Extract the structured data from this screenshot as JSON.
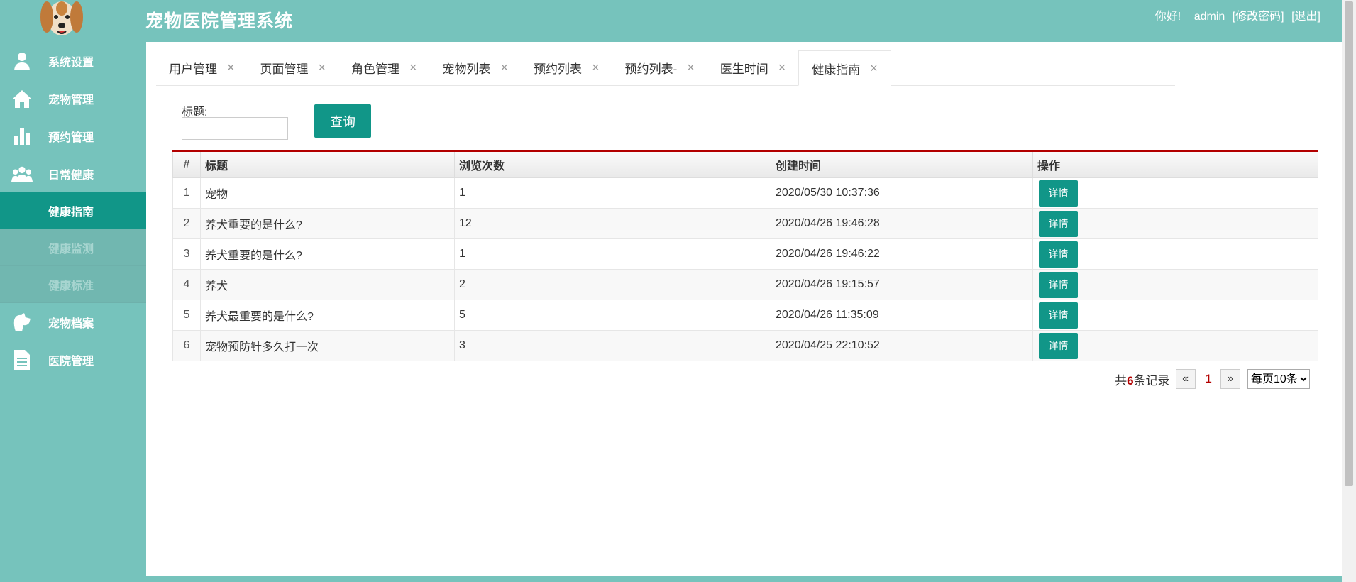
{
  "header": {
    "title": "宠物医院管理系统",
    "greeting": "你好!",
    "username": "admin",
    "change_password": "[修改密码]",
    "logout": "[退出]"
  },
  "sidebar": {
    "items": [
      {
        "label": "系统设置",
        "icon": "user-icon"
      },
      {
        "label": "宠物管理",
        "icon": "home-icon"
      },
      {
        "label": "预约管理",
        "icon": "bar-chart-icon"
      },
      {
        "label": "日常健康",
        "icon": "group-icon"
      }
    ],
    "submenu": [
      {
        "label": "健康指南",
        "active": true
      },
      {
        "label": "健康监测",
        "active": false
      },
      {
        "label": "健康标准",
        "active": false
      }
    ],
    "items_after": [
      {
        "label": "宠物档案",
        "icon": "pet-icon"
      },
      {
        "label": "医院管理",
        "icon": "document-icon"
      }
    ]
  },
  "tabs": [
    {
      "label": "用户管理"
    },
    {
      "label": "页面管理"
    },
    {
      "label": "角色管理"
    },
    {
      "label": "宠物列表"
    },
    {
      "label": "预约列表"
    },
    {
      "label": "预约列表-"
    },
    {
      "label": "医生时间"
    },
    {
      "label": "健康指南",
      "active": true
    }
  ],
  "search": {
    "label": "标题:",
    "value": "",
    "button": "查询"
  },
  "table": {
    "headers": [
      "#",
      "标题",
      "浏览次数",
      "创建时间",
      "操作"
    ],
    "rows": [
      [
        "1",
        "宠物",
        "1",
        "2020/05/30 10:37:36",
        "详情"
      ],
      [
        "2",
        "养犬重要的是什么?",
        "12",
        "2020/04/26 19:46:28",
        "详情"
      ],
      [
        "3",
        "养犬重要的是什么?",
        "1",
        "2020/04/26 19:46:22",
        "详情"
      ],
      [
        "4",
        "养犬",
        "2",
        "2020/04/26 19:15:57",
        "详情"
      ],
      [
        "5",
        "养犬最重要的是什么?",
        "5",
        "2020/04/26 11:35:09",
        "详情"
      ],
      [
        "6",
        "宠物预防针多久打一次",
        "3",
        "2020/04/25 22:10:52",
        "详情"
      ]
    ]
  },
  "pager": {
    "total_prefix": "共",
    "total_count": "6",
    "total_suffix": "条记录",
    "prev": "«",
    "current_page": "1",
    "next": "»",
    "page_size": "每页10条"
  },
  "colors": {
    "brand": "#76c3bc",
    "accent": "#119688",
    "highlight": "#b30000"
  }
}
